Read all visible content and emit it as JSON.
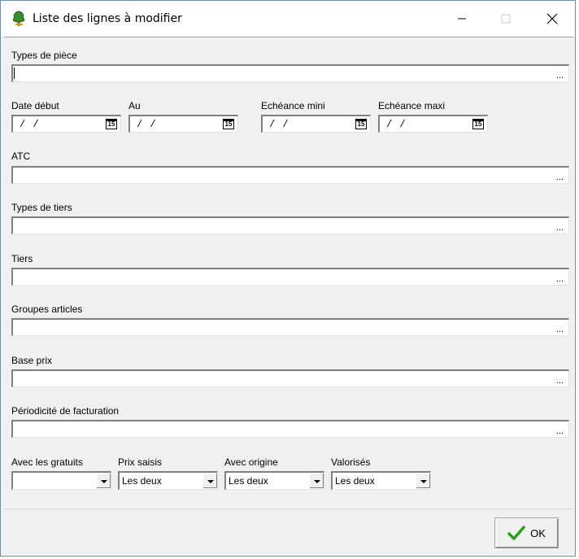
{
  "window": {
    "title": "Liste des lignes à modifier",
    "icons": {
      "app": "app-tree-icon",
      "minimize": "minimize-icon",
      "maximize": "maximize-icon",
      "close": "close-icon"
    }
  },
  "fields": {
    "types_piece": {
      "label": "Types de pièce",
      "value": "",
      "button": "..."
    },
    "date_debut": {
      "label": "Date début",
      "value": "/ /",
      "calendar": "15"
    },
    "au": {
      "label": "Au",
      "value": "/ /",
      "calendar": "15"
    },
    "echeance_mini": {
      "label": "Echéance mini",
      "value": "/ /",
      "calendar": "15"
    },
    "echeance_maxi": {
      "label": "Echéance maxi",
      "value": "/ /",
      "calendar": "15"
    },
    "atc": {
      "label": "ATC",
      "value": "",
      "button": "..."
    },
    "types_tiers": {
      "label": "Types de tiers",
      "value": "",
      "button": "..."
    },
    "tiers": {
      "label": "Tiers",
      "value": "",
      "button": "..."
    },
    "groupes_articles": {
      "label": "Groupes articles",
      "value": "",
      "button": "..."
    },
    "base_prix": {
      "label": "Base prix",
      "value": "",
      "button": "..."
    },
    "periodicite": {
      "label": "Périodicité de facturation",
      "value": "",
      "button": "..."
    },
    "avec_gratuits": {
      "label": "Avec les gratuits",
      "value": ""
    },
    "prix_saisis": {
      "label": "Prix saisis",
      "value": "Les deux"
    },
    "avec_origine": {
      "label": "Avec origine",
      "value": "Les deux"
    },
    "valorises": {
      "label": "Valorisés",
      "value": "Les deux"
    }
  },
  "buttons": {
    "ok": "OK"
  },
  "colors": {
    "ok_check": "#2e9e1f",
    "frame": "#6c8fb3",
    "dialog_bg": "#f0f0f0"
  }
}
